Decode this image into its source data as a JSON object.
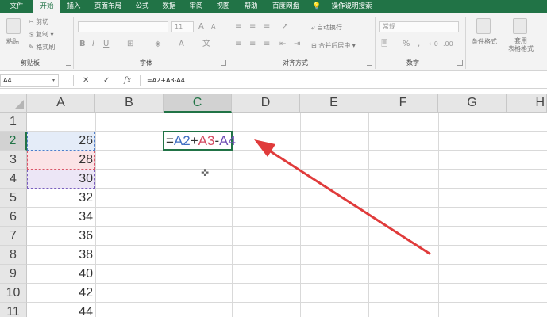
{
  "ribbon_tabs": [
    "文件",
    "开始",
    "插入",
    "页面布局",
    "公式",
    "数据",
    "审阅",
    "视图",
    "帮助",
    "百度网盘",
    "操作说明搜索"
  ],
  "active_tab": "开始",
  "clipboard": {
    "paste": "粘贴",
    "cut": "剪切",
    "copy": "复制",
    "format_painter": "格式刷",
    "label": "剪贴板"
  },
  "font_group": {
    "size": "11",
    "label": "字体"
  },
  "alignment_group": {
    "wrap": "自动换行",
    "merge": "合并后居中",
    "label": "对齐方式"
  },
  "number_group": {
    "format": "常规",
    "label": "数字"
  },
  "styles_group": {
    "conditional": "条件格式",
    "table_format": "套用\n表格格式"
  },
  "formula_bar": {
    "name_box": "A4",
    "cancel": "✕",
    "enter": "✓",
    "fx": "fx",
    "content": "=A2+A3-A4"
  },
  "columns": [
    "A",
    "B",
    "C",
    "D",
    "E",
    "F",
    "G",
    "H"
  ],
  "rows": [
    "1",
    "2",
    "3",
    "4",
    "5",
    "6",
    "7",
    "8",
    "9",
    "10",
    "11"
  ],
  "column_a_values": [
    "",
    "26",
    "28",
    "30",
    "32",
    "34",
    "36",
    "38",
    "40",
    "42",
    "44"
  ],
  "editing_cell": {
    "address": "C2",
    "parts": [
      "=",
      "A2",
      "+",
      "A3",
      "-",
      "A4"
    ]
  },
  "colors": {
    "excel_green": "#217346",
    "ref1": "#3f6ec2",
    "ref2": "#d34a60",
    "ref3": "#7050b5",
    "arrow": "#e03b3b"
  }
}
